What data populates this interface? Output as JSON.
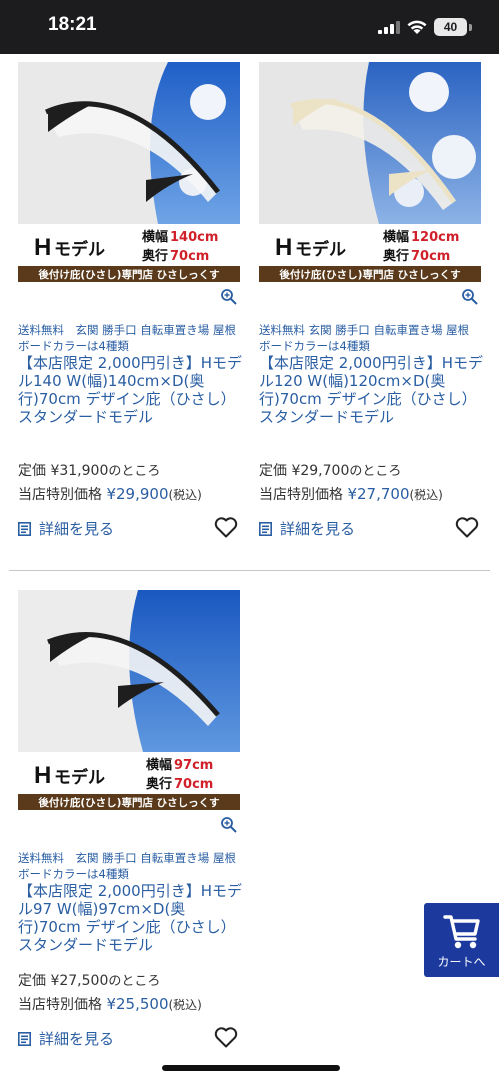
{
  "status": {
    "time": "18:21",
    "battery": "40"
  },
  "products": [
    {
      "model": "H",
      "model_suffix": "モデル",
      "width_label": "横幅",
      "width_value": "140cm",
      "depth_label": "奥行",
      "depth_value": "70cm",
      "banner": "後付け庇(ひさし)専門店 ひさしっくす",
      "frame_color": "#1e1e1e",
      "tags": "送料無料　玄関 勝手口 自転車置き場 屋根 ボードカラーは4種類",
      "title": "【本店限定 2,000円引き】Hモデル140 W(幅)140cm×D(奥行)70cm デザイン庇（ひさし）スタンダードモデル",
      "list_price_label": "定価",
      "list_price": "¥31,900",
      "list_price_suffix": "のところ",
      "sale_label": "当店特別価格",
      "sale_price": "¥29,900",
      "tax_note": "(税込)",
      "detail_label": "詳細を見る"
    },
    {
      "model": "H",
      "model_suffix": "モデル",
      "width_label": "横幅",
      "width_value": "120cm",
      "depth_label": "奥行",
      "depth_value": "70cm",
      "banner": "後付け庇(ひさし)専門店 ひさしっくす",
      "frame_color": "#ece3c6",
      "tags": "送料無料 玄関 勝手口 自転車置き場 屋根 ボードカラーは4種類",
      "title": "【本店限定 2,000円引き】Hモデル120 W(幅)120cm×D(奥行)70cm デザイン庇（ひさし）スタンダードモデル",
      "list_price_label": "定価",
      "list_price": "¥29,700",
      "list_price_suffix": "のところ",
      "sale_label": "当店特別価格",
      "sale_price": "¥27,700",
      "tax_note": "(税込)",
      "detail_label": "詳細を見る"
    },
    {
      "model": "H",
      "model_suffix": "モデル",
      "width_label": "横幅",
      "width_value": "97cm",
      "depth_label": "奥行",
      "depth_value": "70cm",
      "banner": "後付け庇(ひさし)専門店 ひさしっくす",
      "frame_color": "#1e1e1e",
      "tags": "送料無料　玄関 勝手口 自転車置き場 屋根 ボードカラーは4種類",
      "title": "【本店限定 2,000円引き】Hモデル97 W(幅)97cm×D(奥行)70cm デザイン庇（ひさし）スタンダードモデル",
      "list_price_label": "定価",
      "list_price": "¥27,500",
      "list_price_suffix": "のところ",
      "sale_label": "当店特別価格",
      "sale_price": "¥25,500",
      "tax_note": "(税込)",
      "detail_label": "詳細を見る"
    }
  ],
  "cart": {
    "label": "カートへ"
  },
  "colors": {
    "link_blue": "#2a5ea3",
    "cart_blue": "#1c3a9e",
    "banner_brown": "#5a3a1a",
    "dim_red": "#d0202a"
  }
}
